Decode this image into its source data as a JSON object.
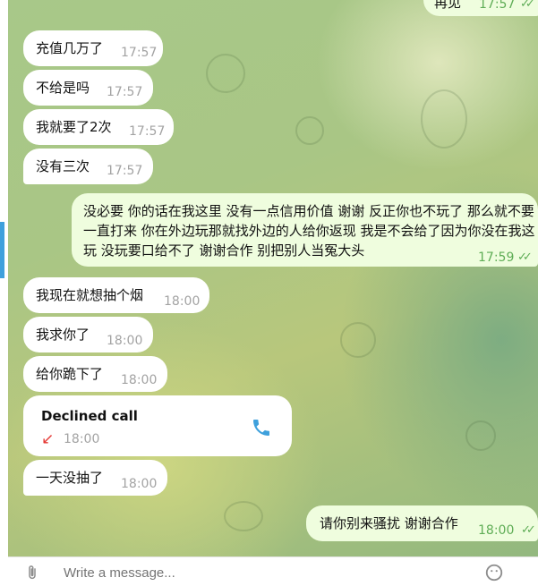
{
  "messages": [
    {
      "id": "m0",
      "dir": "out",
      "text": "再见",
      "time": "17:57",
      "read": true
    },
    {
      "id": "m1",
      "dir": "in",
      "text": "充值几万了",
      "time": "17:57"
    },
    {
      "id": "m2",
      "dir": "in",
      "text": "不给是吗",
      "time": "17:57"
    },
    {
      "id": "m3",
      "dir": "in",
      "text": "我就要了2次",
      "time": "17:57"
    },
    {
      "id": "m4",
      "dir": "in",
      "text": "没有三次",
      "time": "17:57"
    },
    {
      "id": "m5",
      "dir": "out",
      "text": "没必要 你的话在我这里 没有一点信用价值 谢谢 反正你也不玩了 那么就不要一直打来 你在外边玩那就找外边的人给你返现 我是不会给了因为你没在我这玩 没玩要口给不了 谢谢合作 别把别人当冤大头",
      "time": "17:59",
      "read": true
    },
    {
      "id": "m6",
      "dir": "in",
      "text": "我现在就想抽个烟",
      "time": "18:00"
    },
    {
      "id": "m7",
      "dir": "in",
      "text": "我求你了",
      "time": "18:00"
    },
    {
      "id": "m8",
      "dir": "in",
      "text": "给你跪下了",
      "time": "18:00"
    },
    {
      "id": "m9",
      "dir": "in",
      "type": "call",
      "text": "Declined call",
      "time": "18:00"
    },
    {
      "id": "m10",
      "dir": "in",
      "text": "一天没抽了",
      "time": "18:00"
    },
    {
      "id": "m11",
      "dir": "out",
      "text": "请你别来骚扰 谢谢合作",
      "time": "18:00",
      "read": true
    }
  ],
  "composer": {
    "placeholder": "Write a message..."
  },
  "icons": {
    "call": "phone-icon",
    "declined": "arrow-down-left-icon",
    "read": "double-check-icon",
    "attach": "paperclip-icon",
    "emoji": "smile-icon"
  },
  "colors": {
    "outgoing_bubble": "#effdde",
    "incoming_bubble": "#ffffff",
    "check": "#5fad56",
    "declined": "#e53935",
    "phone": "#3ea0dc"
  }
}
